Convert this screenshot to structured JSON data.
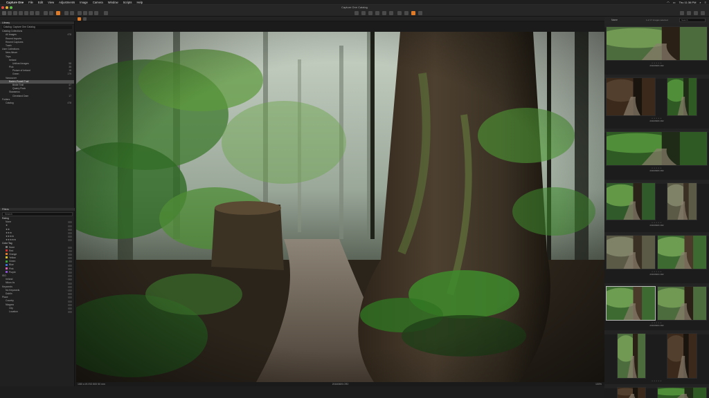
{
  "menubar": {
    "apple": "",
    "items": [
      "Capture One",
      "File",
      "Edit",
      "View",
      "Adjustments",
      "Image",
      "Camera",
      "Window",
      "Scripts",
      "Help"
    ],
    "clock": "Thu 11:36 PM"
  },
  "window": {
    "title": "Capture One Catalog"
  },
  "colors": {
    "accent": "#e07b2a",
    "selection": "#4e4e4e"
  },
  "library": {
    "header": "Library",
    "catalog_selector": "Catalog: Capture One Catalog",
    "items": [
      {
        "label": "Catalog Collections",
        "indent": 0,
        "count": ""
      },
      {
        "label": "All Images",
        "indent": 1,
        "count": "478"
      },
      {
        "label": "Recent Imports",
        "indent": 1,
        "count": ""
      },
      {
        "label": "Recent Captures",
        "indent": 1,
        "count": ""
      },
      {
        "label": "Trash",
        "indent": 1,
        "count": ""
      },
      {
        "label": "User Collections",
        "indent": 0,
        "count": ""
      },
      {
        "label": "New Album",
        "indent": 1,
        "count": ""
      },
      {
        "label": "Trips",
        "indent": 1,
        "count": ""
      },
      {
        "label": "Ireland",
        "indent": 2,
        "count": ""
      },
      {
        "label": "Unfixed Images",
        "indent": 3,
        "count": "98"
      },
      {
        "label": "Pick",
        "indent": 2,
        "count": "35"
      },
      {
        "label": "Picture of Ireland",
        "indent": 3,
        "count": "18"
      },
      {
        "label": "Green",
        "indent": 3,
        "count": "179"
      },
      {
        "label": "Vancouver",
        "indent": 1,
        "count": ""
      },
      {
        "label": "Baden-Powell Trail",
        "indent": 2,
        "count": "",
        "selected": true
      },
      {
        "label": "Bridle Trail",
        "indent": 3,
        "count": "47"
      },
      {
        "label": "Quarry Rock",
        "indent": 3,
        "count": "30"
      },
      {
        "label": "Stawamus",
        "indent": 2,
        "count": ""
      },
      {
        "label": "Cleveland Dam",
        "indent": 3,
        "count": "17"
      },
      {
        "label": "Folders",
        "indent": 0,
        "count": ""
      },
      {
        "label": "Catalog",
        "indent": 1,
        "count": "478"
      }
    ]
  },
  "filters": {
    "header": "Filters",
    "search_placeholder": "Search",
    "rating_header": "Rating",
    "ratings": [
      {
        "label": "None",
        "count": "1"
      },
      {
        "label": "★",
        "count": "0"
      },
      {
        "label": "★★",
        "count": "0"
      },
      {
        "label": "★★★",
        "count": "0"
      },
      {
        "label": "★★★★",
        "count": "0"
      },
      {
        "label": "★★★★★",
        "count": "0"
      }
    ],
    "color_tag_header": "Color Tag",
    "color_tags": [
      {
        "label": "None",
        "color": "#777777"
      },
      {
        "label": "Red",
        "color": "#d23030"
      },
      {
        "label": "Orange",
        "color": "#e07b2a"
      },
      {
        "label": "Yellow",
        "color": "#d8c32a"
      },
      {
        "label": "Green",
        "color": "#3aa73a"
      },
      {
        "label": "Blue",
        "color": "#3a6fd8"
      },
      {
        "label": "Pink",
        "color": "#d85fb0"
      },
      {
        "label": "Purple",
        "color": "#8a4fd0"
      }
    ],
    "other_rows": [
      {
        "label": "ISO",
        "indent": 0
      },
      {
        "label": "Ireland",
        "indent": 1
      },
      {
        "label": "Nikon 4s",
        "indent": 1
      },
      {
        "label": "Keywords",
        "indent": 0
      },
      {
        "label": "No Keywords",
        "indent": 1
      },
      {
        "label": "Dublin",
        "indent": 1
      },
      {
        "label": "Place",
        "indent": 0
      },
      {
        "label": "Country",
        "indent": 1
      },
      {
        "label": "Niagara",
        "indent": 1
      },
      {
        "label": "City",
        "indent": 2
      },
      {
        "label": "Location",
        "indent": 2
      }
    ]
  },
  "viewer": {
    "filename": "20160609.CR2",
    "info_left": "1/80 s  f/4  ISO 800  50 mm",
    "zoom": "100%"
  },
  "browser": {
    "sort_label": "Name",
    "search_placeholder": "Search",
    "count_label": "1 of 17 images selected",
    "filenames": [
      "20160608.CR2",
      "20160608.CR2",
      "20160608.CR2",
      "20160608.CR2",
      "20160609.CR2",
      "20160609.CR2"
    ]
  }
}
